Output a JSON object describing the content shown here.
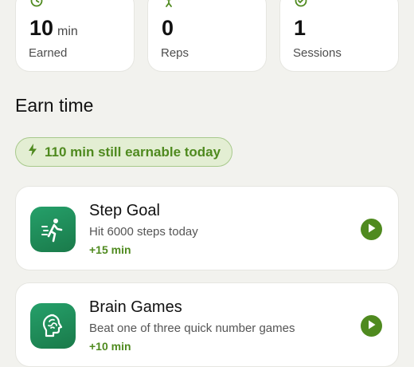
{
  "stats": [
    {
      "value": "10",
      "unit": "min",
      "label": "Earned",
      "icon": "clock-icon"
    },
    {
      "value": "0",
      "unit": "",
      "label": "Reps",
      "icon": "figure-icon"
    },
    {
      "value": "1",
      "unit": "",
      "label": "Sessions",
      "icon": "check-circle-icon"
    }
  ],
  "section": {
    "title": "Earn time"
  },
  "earnable": {
    "text": "110 min still earnable today",
    "icon": "bolt-icon"
  },
  "activities": [
    {
      "title": "Step Goal",
      "description": "Hit 6000 steps today",
      "reward": "+15 min",
      "icon": "walking-icon"
    },
    {
      "title": "Brain Games",
      "description": "Beat one of three quick number games",
      "reward": "+10 min",
      "icon": "brain-icon"
    }
  ],
  "colors": {
    "accent": "#4f8a1f",
    "background": "#f2f2ee",
    "card": "#ffffff",
    "icon_tile": "#1f8a57"
  }
}
